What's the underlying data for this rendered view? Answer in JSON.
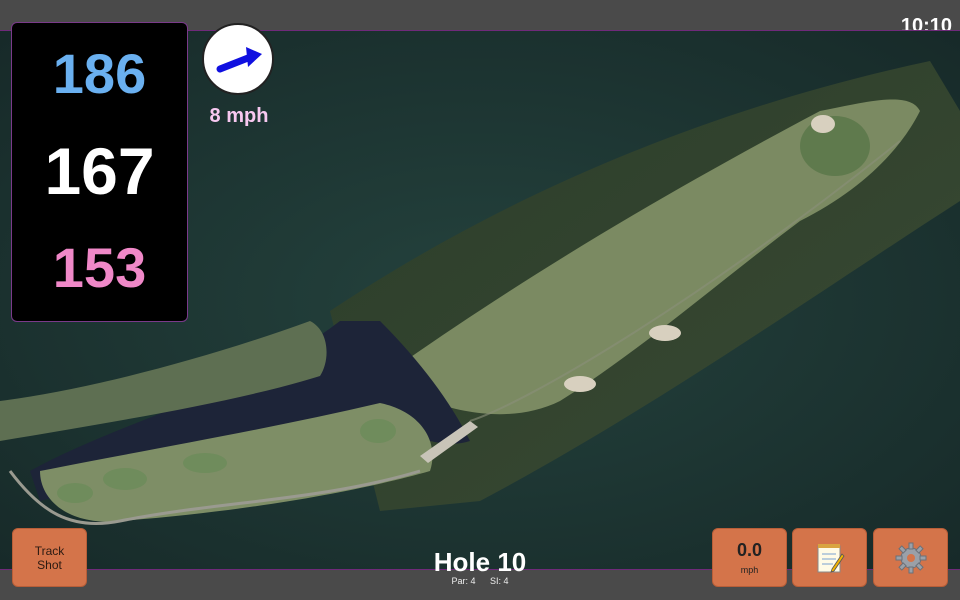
{
  "status": {
    "clock": "10:10"
  },
  "yardages": {
    "back": "186",
    "middle": "167",
    "front": "153"
  },
  "wind": {
    "speed": "8 mph",
    "icon": "wind-arrow-icon"
  },
  "hole": {
    "title": "Hole 10",
    "par": "Par: 4",
    "stroke_index": "SI: 4"
  },
  "buttons": {
    "track_shot_line1": "Track",
    "track_shot_line2": "Shot",
    "speed_value": "0.0",
    "speed_unit": "mph",
    "notes_icon": "notepad-icon",
    "settings_icon": "gear-icon"
  },
  "colors": {
    "back": "#6ab0f0",
    "middle": "#ffffff",
    "front": "#f088c8",
    "wind_text": "#f7c8f0",
    "button": "#d4744a"
  }
}
